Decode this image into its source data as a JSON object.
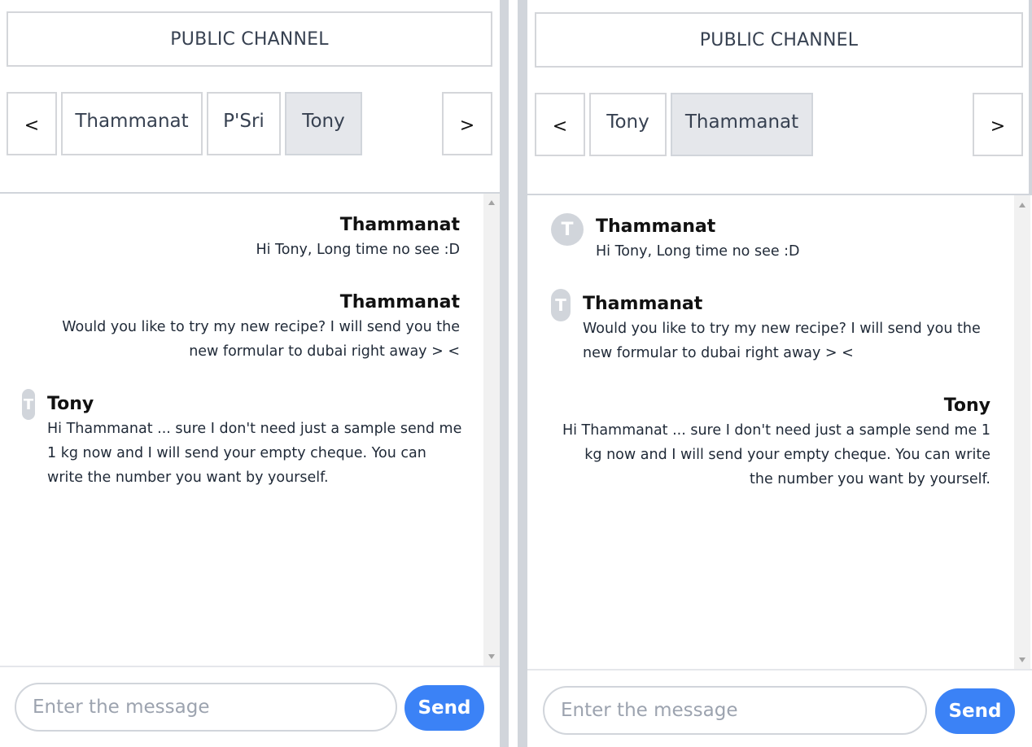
{
  "left": {
    "channel_label": "PUBLIC CHANNEL",
    "nav_prev": "<",
    "nav_next": ">",
    "tabs": [
      "Thammanat",
      "P'Sri",
      "Tony"
    ],
    "active_tab": "Tony",
    "messages": [
      {
        "sender": "Thammanat",
        "lines": [
          "Hi Tony, Long time no see :D"
        ]
      },
      {
        "sender": "Thammanat",
        "lines": [
          "Would you like to try my new recipe? I will send you the",
          "new formular to dubai right away > <"
        ]
      },
      {
        "sender": "Tony",
        "avatar": "T",
        "lines": [
          "Hi Thammanat ... sure I don't need just a sample send me",
          "1 kg now and I will send your empty cheque. You can",
          "write the number you want by yourself."
        ]
      }
    ],
    "input_placeholder": "Enter the message",
    "send_label": "Send"
  },
  "right": {
    "channel_label": "PUBLIC CHANNEL",
    "nav_prev": "<",
    "nav_next": ">",
    "tabs": [
      "Tony",
      "Thammanat"
    ],
    "active_tab": "Thammanat",
    "messages": [
      {
        "sender": "Thammanat",
        "avatar": "T",
        "lines": [
          "Hi Tony, Long time no see :D"
        ]
      },
      {
        "sender": "Thammanat",
        "avatar": "T",
        "lines": [
          "Would you like to try my new recipe? I will send you the",
          "new formular to dubai right away > <"
        ]
      },
      {
        "sender": "Tony",
        "lines": [
          "Hi Thammanat ... sure I don't need just a sample send me 1",
          "kg now and I will send your empty cheque. You can write",
          "the number you want by yourself."
        ]
      }
    ],
    "input_placeholder": "Enter the message",
    "send_label": "Send"
  },
  "colors": {
    "send": "#3b82f6",
    "active_tab": "#e5e7eb",
    "border": "#d4d6da",
    "avatar": "#d1d5db"
  }
}
